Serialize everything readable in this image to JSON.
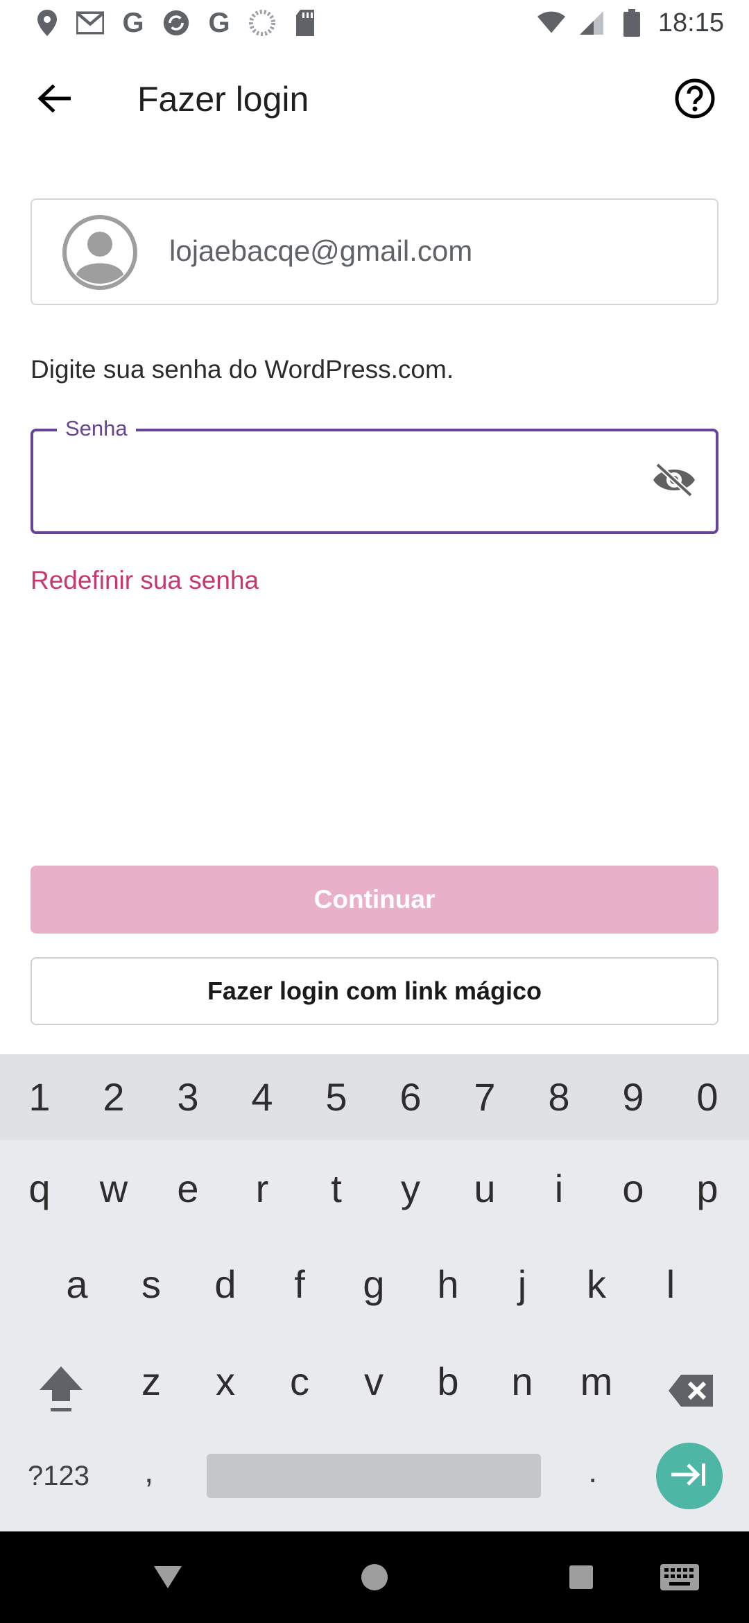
{
  "status_bar": {
    "time": "18:15",
    "left_icons": [
      "location-icon",
      "gmail-icon",
      "google-icon",
      "sync-icon",
      "google-icon",
      "loading-icon",
      "sd-card-icon"
    ],
    "right_icons": [
      "wifi-icon",
      "cell-signal-icon",
      "battery-icon"
    ]
  },
  "app_bar": {
    "title": "Fazer login",
    "back_icon": "arrow-back-icon",
    "help_icon": "help-icon"
  },
  "account": {
    "email": "lojaebacqe@gmail.com",
    "avatar_icon": "avatar-icon"
  },
  "form": {
    "instructions": "Digite sua senha do WordPress.com.",
    "password_label": "Senha",
    "password_value": "",
    "visibility_icon": "eye-off-icon",
    "reset_link": "Redefinir sua senha"
  },
  "actions": {
    "continue_label": "Continuar",
    "magic_link_label": "Fazer login com link mágico"
  },
  "keyboard": {
    "numbers": [
      "1",
      "2",
      "3",
      "4",
      "5",
      "6",
      "7",
      "8",
      "9",
      "0"
    ],
    "row1": [
      "q",
      "w",
      "e",
      "r",
      "t",
      "y",
      "u",
      "i",
      "o",
      "p"
    ],
    "row2": [
      "a",
      "s",
      "d",
      "f",
      "g",
      "h",
      "j",
      "k",
      "l"
    ],
    "row3": [
      "z",
      "x",
      "c",
      "v",
      "b",
      "n",
      "m"
    ],
    "symbols_label": "?123",
    "comma": ",",
    "period": ".",
    "shift_icon": "shift-icon",
    "backspace_icon": "backspace-icon",
    "enter_icon": "tab-enter-icon"
  },
  "nav_bar": {
    "icons": [
      "nav-back-icon",
      "nav-home-icon",
      "nav-recents-icon",
      "keyboard-switch-icon"
    ]
  },
  "colors": {
    "accent_purple": "#674399",
    "link_pink": "#c9356e",
    "continue_disabled": "#e9b0c9",
    "enter_teal": "#4db6a4"
  }
}
